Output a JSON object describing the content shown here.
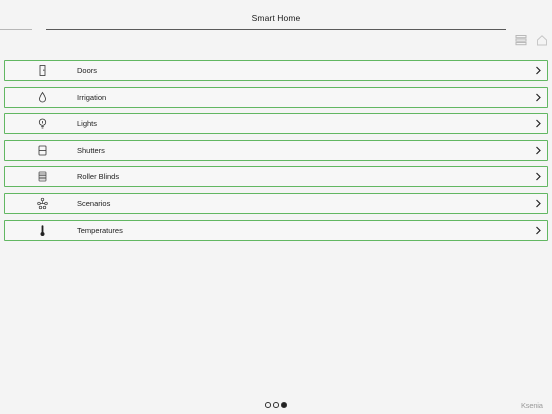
{
  "header": {
    "title": "Smart Home"
  },
  "toolbar": {
    "menu_icon": "list-icon",
    "home_icon": "home-icon"
  },
  "menu": {
    "items": [
      {
        "label": "Doors",
        "icon": "door-icon"
      },
      {
        "label": "Irrigation",
        "icon": "water-drop-icon"
      },
      {
        "label": "Lights",
        "icon": "light-bulb-icon"
      },
      {
        "label": "Shutters",
        "icon": "shutter-icon"
      },
      {
        "label": "Roller Blinds",
        "icon": "roller-blind-icon"
      },
      {
        "label": "Scenarios",
        "icon": "scenario-icon"
      },
      {
        "label": "Temperatures",
        "icon": "thermometer-icon"
      }
    ]
  },
  "pager": {
    "pages": 3,
    "current": 3
  },
  "brand": {
    "logo_text": "Ksenia"
  },
  "colors": {
    "accent": "#62b762",
    "background": "#f4f4f4"
  }
}
